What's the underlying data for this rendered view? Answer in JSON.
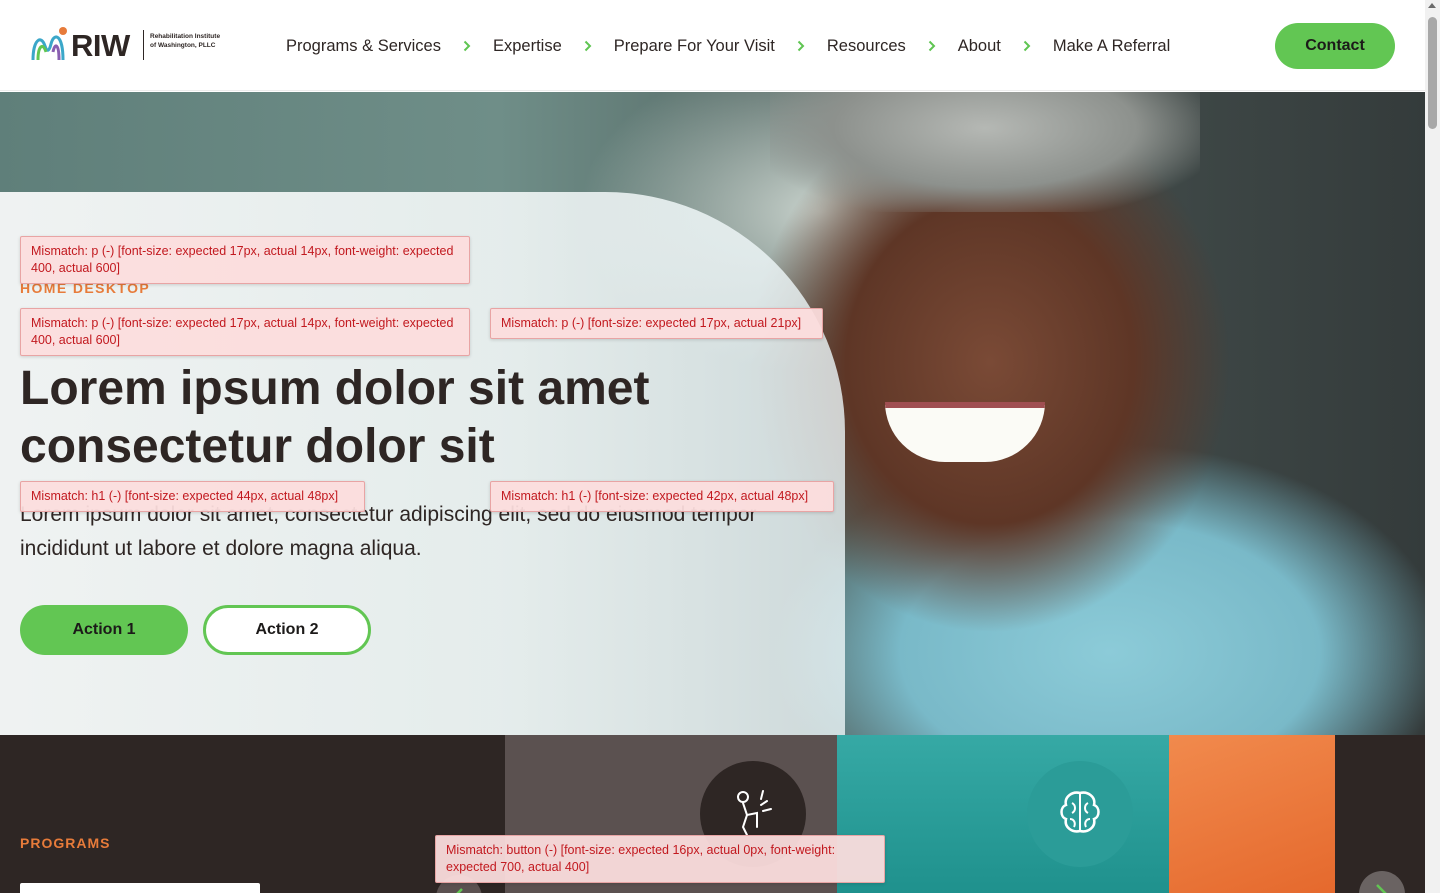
{
  "header": {
    "logo": {
      "wordmark": "RIW",
      "subtitle": "Rehabilitation Institute of Washington, PLLC"
    },
    "nav": [
      {
        "label": "Programs & Services"
      },
      {
        "label": "Expertise"
      },
      {
        "label": "Prepare For Your Visit"
      },
      {
        "label": "Resources"
      },
      {
        "label": "About"
      },
      {
        "label": "Make A Referral"
      }
    ],
    "contact_label": "Contact"
  },
  "hero": {
    "eyebrow": "HOME DESKTOP",
    "title": "Lorem ipsum dolor sit amet consectetur dolor sit",
    "description": "Lorem ipsum dolor sit amet, consectetur adipiscing elit, sed do eiusmod tempor incididunt ut labore et dolore magna aliqua.",
    "action1": "Action 1",
    "action2": "Action 2"
  },
  "programs": {
    "label": "PROGRAMS",
    "cards": [
      {
        "icon": "knee-pain-icon",
        "color": "#5b5150"
      },
      {
        "icon": "brain-icon",
        "color": "#2b9c98"
      },
      {
        "icon": "",
        "color": "#e97432"
      }
    ]
  },
  "mismatches": [
    "Mismatch: p (-) [font-size: expected 17px, actual 14px, font-weight: expected 400, actual 600]",
    "Mismatch: p (-) [font-size: expected 17px, actual 14px, font-weight: expected 400, actual 600]",
    "Mismatch: p (-) [font-size: expected 17px, actual 21px]",
    "Mismatch: h1 (-) [font-size: expected 44px, actual 48px]",
    "Mismatch: h1 (-) [font-size: expected 42px, actual 48px]",
    "Mismatch: button (-) [font-size: expected 16px, actual 0px, font-weight: expected 700, actual 400]"
  ],
  "colors": {
    "brand_green": "#62c653",
    "accent_orange": "#e77b3a",
    "dark": "#2e2624",
    "teal": "#2b9c98",
    "error_text": "#c2191f"
  }
}
